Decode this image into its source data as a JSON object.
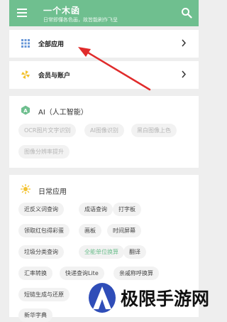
{
  "app": {
    "title": "一个木函",
    "subtitle": "日常即懂各色画，故皆能刷作飞呈"
  },
  "colors": {
    "accent": "#6fbf8f",
    "arrow": "#e02b2b"
  },
  "rows": [
    {
      "label": "全部应用",
      "icon": "grid-icon"
    },
    {
      "label": "会员与账户",
      "icon": "pinwheel-icon"
    }
  ],
  "ai_section": {
    "title": "AI（人工智能）",
    "chips": [
      "OCR图片文字识别",
      "AI图像识别",
      "黑白图像上色",
      "图像分辨率提升"
    ]
  },
  "daily_section": {
    "title": "日常应用",
    "chips": [
      "近反义词查询",
      "成语查询",
      "打字板",
      "领取红包得彩蛋",
      "画板",
      "时间屏幕",
      "垃圾分类查询",
      "全能单位换算",
      "翻译",
      "汇率转换",
      "快递查询Lite",
      "亲戚称呼换算",
      "短链生成与还原",
      "新华字典"
    ]
  },
  "watermark": {
    "text": "极限手游网"
  }
}
